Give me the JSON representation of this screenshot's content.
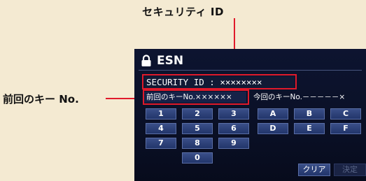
{
  "annotations": {
    "security_id_label": "セキュリティ ID",
    "previous_key_label": "前回のキー No."
  },
  "screen": {
    "title": "ESN",
    "security_id": "SECURITY ID : ××××××××",
    "previous_key": "前回のキーNo.××××××",
    "current_key": "今回のキーNo.－－－－－×"
  },
  "keypad": {
    "rows": [
      [
        "1",
        "2",
        "3",
        "A",
        "B",
        "C"
      ],
      [
        "4",
        "5",
        "6",
        "D",
        "E",
        "F"
      ],
      [
        "7",
        "8",
        "9"
      ],
      [
        "0"
      ]
    ],
    "clear_label": "クリア",
    "enter_label": "決定"
  },
  "colors": {
    "callout": "#e01a2b",
    "screen_bg": "#0a1026",
    "key_bg": "#2b3f78"
  }
}
